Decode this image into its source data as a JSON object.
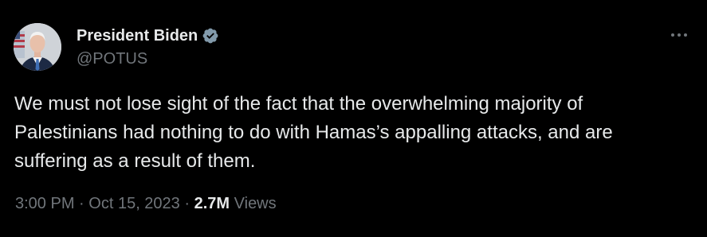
{
  "tweet": {
    "author": {
      "display_name": "President Biden",
      "handle": "@POTUS",
      "verified_icon": "verified-badge-icon",
      "avatar_icon": "profile-photo"
    },
    "more_icon": "more-options-icon",
    "text": "We must not lose sight of the fact that the overwhelming majority of\nPalestinians had nothing to do with Hamas’s appalling attacks, and are\nsuffering as a result of them.",
    "time": "3:00 PM",
    "separator": "·",
    "date": "Oct 15, 2023",
    "views_count": "2.7M",
    "views_label": "Views"
  },
  "colors": {
    "background": "#000000",
    "primary_text": "#e7e9ea",
    "secondary_text": "#71767b",
    "verified_badge": "#829aab"
  }
}
